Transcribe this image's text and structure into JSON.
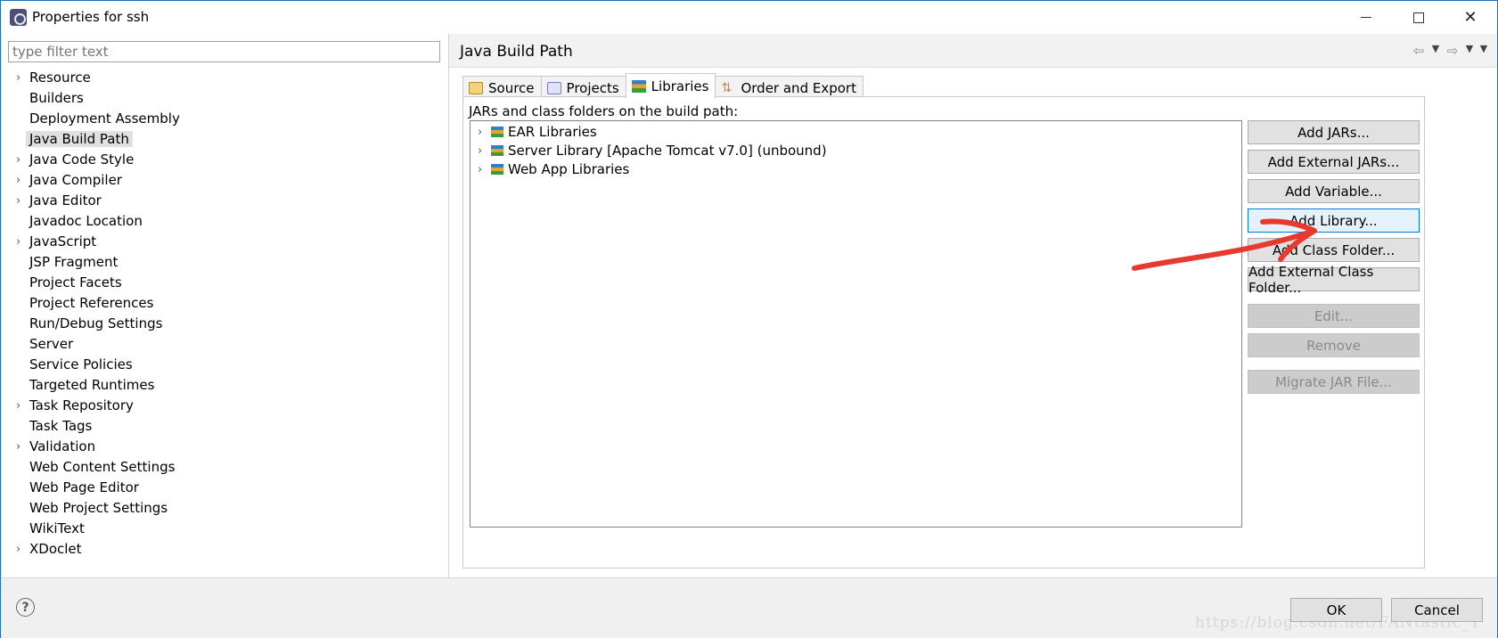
{
  "window": {
    "title": "Properties for ssh",
    "minimize_icon": "minimize-icon",
    "maximize_icon": "maximize-icon",
    "close_icon": "close-icon"
  },
  "filter": {
    "placeholder": "type filter text",
    "value": ""
  },
  "tree": [
    {
      "label": "Resource",
      "expandable": true
    },
    {
      "label": "Builders",
      "expandable": false
    },
    {
      "label": "Deployment Assembly",
      "expandable": false
    },
    {
      "label": "Java Build Path",
      "expandable": false,
      "selected": true
    },
    {
      "label": "Java Code Style",
      "expandable": true
    },
    {
      "label": "Java Compiler",
      "expandable": true
    },
    {
      "label": "Java Editor",
      "expandable": true
    },
    {
      "label": "Javadoc Location",
      "expandable": false
    },
    {
      "label": "JavaScript",
      "expandable": true
    },
    {
      "label": "JSP Fragment",
      "expandable": false
    },
    {
      "label": "Project Facets",
      "expandable": false
    },
    {
      "label": "Project References",
      "expandable": false
    },
    {
      "label": "Run/Debug Settings",
      "expandable": false
    },
    {
      "label": "Server",
      "expandable": false
    },
    {
      "label": "Service Policies",
      "expandable": false
    },
    {
      "label": "Targeted Runtimes",
      "expandable": false
    },
    {
      "label": "Task Repository",
      "expandable": true
    },
    {
      "label": "Task Tags",
      "expandable": false
    },
    {
      "label": "Validation",
      "expandable": true
    },
    {
      "label": "Web Content Settings",
      "expandable": false
    },
    {
      "label": "Web Page Editor",
      "expandable": false
    },
    {
      "label": "Web Project Settings",
      "expandable": false
    },
    {
      "label": "WikiText",
      "expandable": false
    },
    {
      "label": "XDoclet",
      "expandable": true
    }
  ],
  "page": {
    "title": "Java Build Path",
    "tabs": [
      {
        "label": "Source",
        "icon": "source-folder-icon"
      },
      {
        "label": "Projects",
        "icon": "projects-icon"
      },
      {
        "label": "Libraries",
        "icon": "library-icon",
        "active": true
      },
      {
        "label": "Order and Export",
        "icon": "order-export-icon"
      }
    ],
    "list_label": "JARs and class folders on the build path:",
    "libraries": [
      "EAR Libraries",
      "Server Library [Apache Tomcat v7.0] (unbound)",
      "Web App Libraries"
    ],
    "buttons": [
      {
        "label": "Add JARs...",
        "state": "normal"
      },
      {
        "label": "Add External JARs...",
        "state": "normal"
      },
      {
        "label": "Add Variable...",
        "state": "normal"
      },
      {
        "label": "Add Library...",
        "state": "focused"
      },
      {
        "label": "Add Class Folder...",
        "state": "normal"
      },
      {
        "label": "Add External Class Folder...",
        "state": "normal"
      },
      {
        "label": "Edit...",
        "state": "disabled"
      },
      {
        "label": "Remove",
        "state": "disabled"
      },
      {
        "label": "Migrate JAR File...",
        "state": "disabled"
      }
    ]
  },
  "footer": {
    "ok": "OK",
    "cancel": "Cancel",
    "watermark": "https://blog.csdn.net/FANtastic_Y"
  },
  "colors": {
    "accent": "#0078d7",
    "annotation": "#e8392f"
  }
}
